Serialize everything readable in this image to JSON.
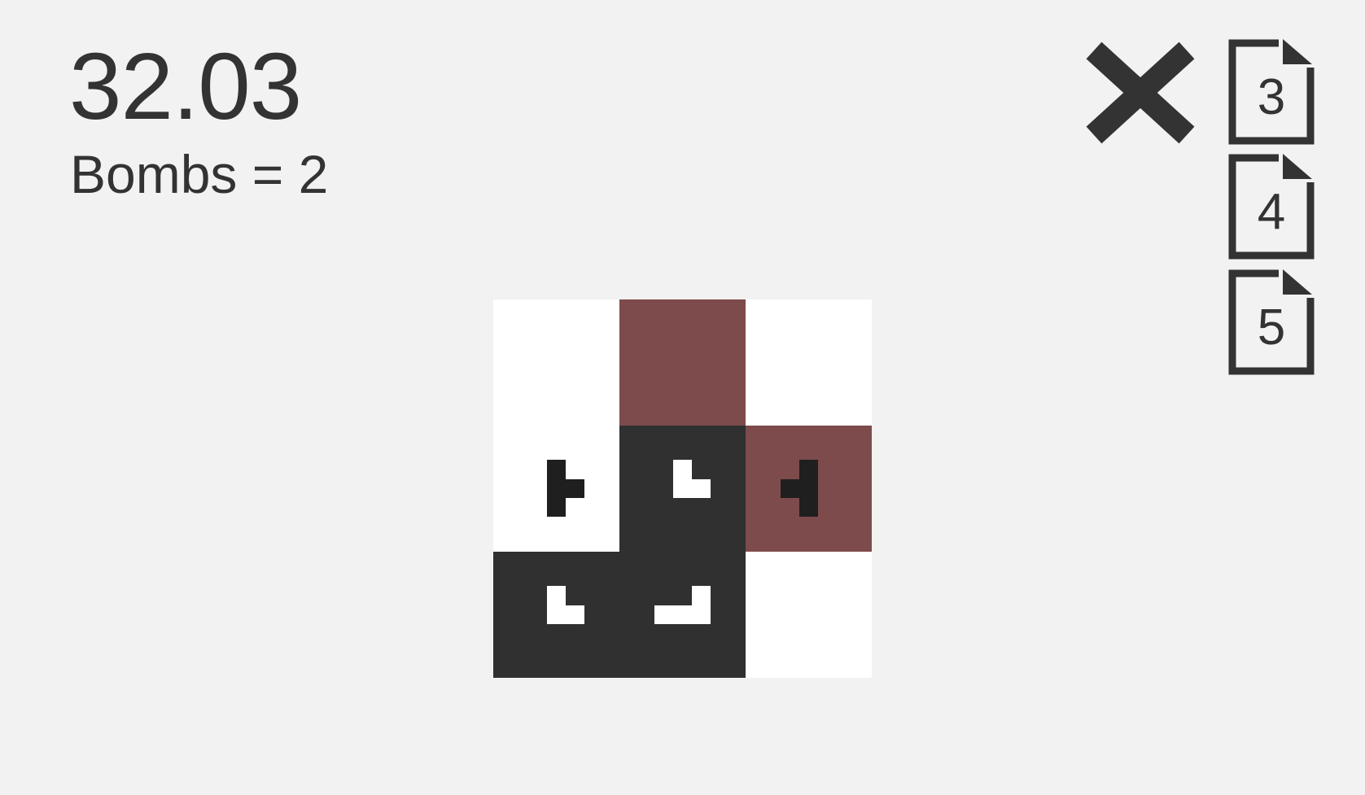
{
  "hud": {
    "timer": "32.03",
    "bombs_text": "Bombs = 2"
  },
  "toolbar": {
    "close_icon": "close-x-icon",
    "levels": [
      {
        "label": "3",
        "icon": "document-icon"
      },
      {
        "label": "4",
        "icon": "document-icon"
      },
      {
        "label": "5",
        "icon": "document-icon"
      }
    ]
  },
  "colors": {
    "background": "#f2f2f2",
    "text": "#333333",
    "cell_white": "#ffffff",
    "cell_dark": "#303030",
    "cell_red": "#7d4b4b",
    "glyph_dark": "#1f1f1f",
    "glyph_light": "#ffffff"
  },
  "board": {
    "rows": 3,
    "cols": 3,
    "cells": [
      {
        "row": 0,
        "col": 0,
        "state": "white",
        "glyph": "none"
      },
      {
        "row": 0,
        "col": 1,
        "state": "red",
        "glyph": "none"
      },
      {
        "row": 0,
        "col": 2,
        "state": "white",
        "glyph": "none"
      },
      {
        "row": 1,
        "col": 0,
        "state": "white",
        "glyph": "tee-right"
      },
      {
        "row": 1,
        "col": 1,
        "state": "dark",
        "glyph": "corner-down-right"
      },
      {
        "row": 1,
        "col": 2,
        "state": "red",
        "glyph": "tee-left"
      },
      {
        "row": 2,
        "col": 0,
        "state": "dark",
        "glyph": "corner-down-right"
      },
      {
        "row": 2,
        "col": 1,
        "state": "dark",
        "glyph": "corner-down-left"
      },
      {
        "row": 2,
        "col": 2,
        "state": "white",
        "glyph": "none"
      }
    ]
  }
}
